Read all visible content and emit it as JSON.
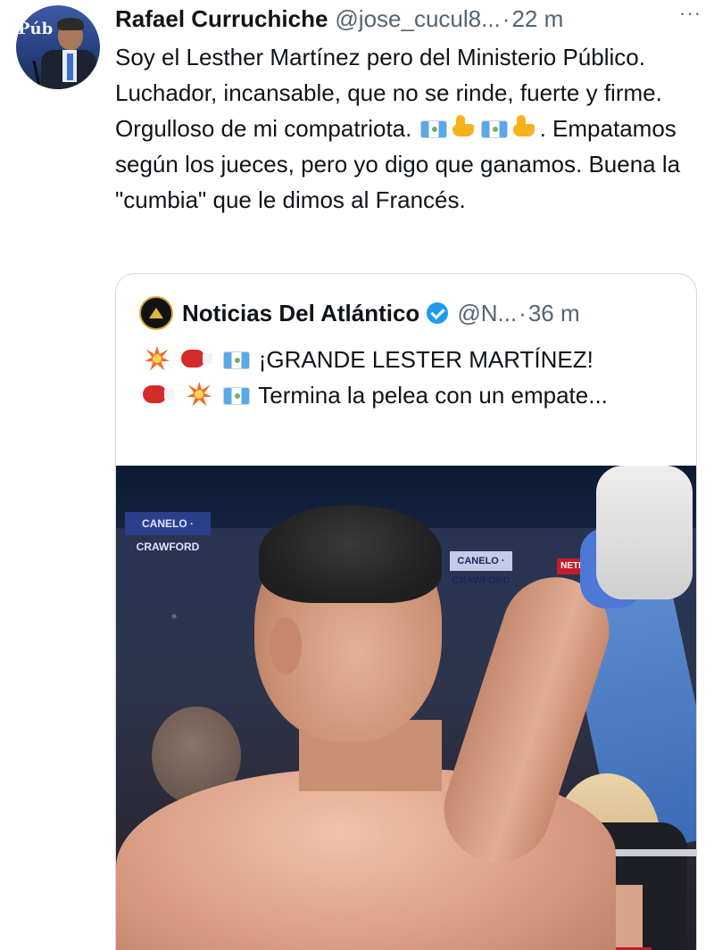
{
  "tweet": {
    "author_name": "Rafael Curruchiche",
    "handle": "@jose_cucul8...",
    "separator": "·",
    "time": "22 m",
    "more_icon": "···",
    "avatar_text": "Púb",
    "text_part1": "Soy el Lesther Martínez pero del Ministerio Público. Luchador, incansable, que no se rinde, fuerte y firme. Orgulloso de mi compatriota.",
    "text_part2": ". Empatamos según los jueces, pero yo digo que ganamos. Buena la \"cumbia\" que le dimos al Francés."
  },
  "quoted": {
    "author_name": "Noticias Del Atlántico",
    "handle": "@N...",
    "separator": "·",
    "time": "36 m",
    "line1": "¡GRANDE LESTER MARTÍNEZ!",
    "line2": "Termina la pelea con un empate...",
    "photo": {
      "banner1": "CANELO · CRAWFORD",
      "banner2": "CANELO · CRAWFORD",
      "banner3": "NETFLIX"
    }
  },
  "icons": {
    "flag": "guatemala-flag-icon",
    "muscle": "flexed-biceps-icon",
    "boom": "collision-icon",
    "glove": "boxing-glove-icon",
    "verified": "verified-badge-icon"
  },
  "colors": {
    "text": "#0f1419",
    "secondary": "#536471",
    "accent": "#1d9bf0",
    "border": "#cfd9de"
  }
}
